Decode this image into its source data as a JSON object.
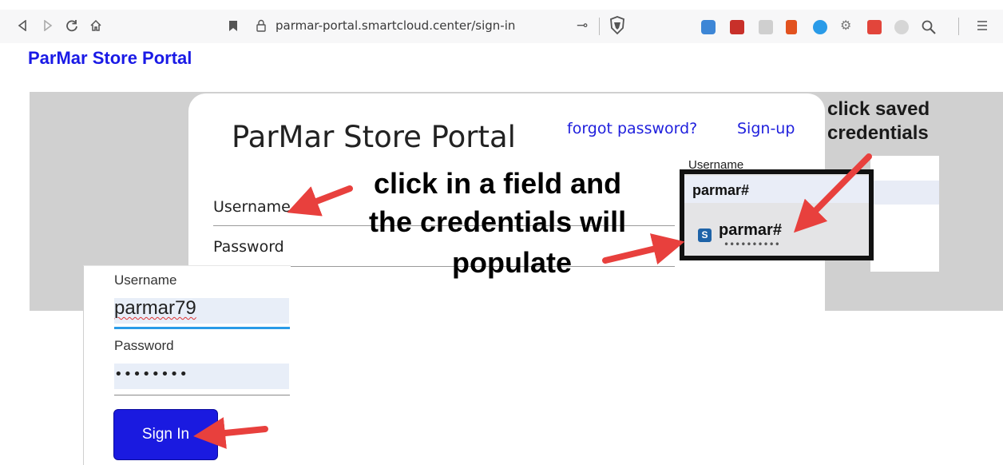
{
  "browser": {
    "url": "parmar-portal.smartcloud.center/sign-in",
    "nav_icons": [
      "back-icon",
      "forward-icon",
      "reload-icon",
      "home-icon",
      "bookmark-icon"
    ],
    "extension_icons": [
      "extension-1-icon",
      "acrobat-icon",
      "extension-3-icon",
      "office-icon",
      "messenger-icon",
      "translate-icon",
      "extension-7-icon",
      "extension-8-icon",
      "search-icon"
    ],
    "menu_icon": "menu-icon"
  },
  "page": {
    "site_title": "ParMar Store Portal"
  },
  "card": {
    "title": "ParMar Store Portal",
    "forgot_link": "forgot password?",
    "signup_link": "Sign-up",
    "username_label": "Username",
    "password_label": "Password"
  },
  "annotations": {
    "main_line1": "click in a field and",
    "main_line2": "the credentials will",
    "main_line3": "populate",
    "side_line1": "click saved",
    "side_line2": "credentials"
  },
  "popup": {
    "caption": "Username",
    "input_value": "parmar#",
    "saved_user": "parmar#",
    "saved_pass": "••••••••••",
    "site_icon_letter": "S"
  },
  "inset": {
    "username_label": "Username",
    "username_value": "parmar79",
    "password_label": "Password",
    "password_value": "••••••••",
    "signin_label": "Sign In"
  },
  "colors": {
    "link_blue": "#1f1fdd",
    "button_blue": "#1a1ae0",
    "arrow_red": "#e8403d",
    "focus_blue": "#2a9be8"
  }
}
